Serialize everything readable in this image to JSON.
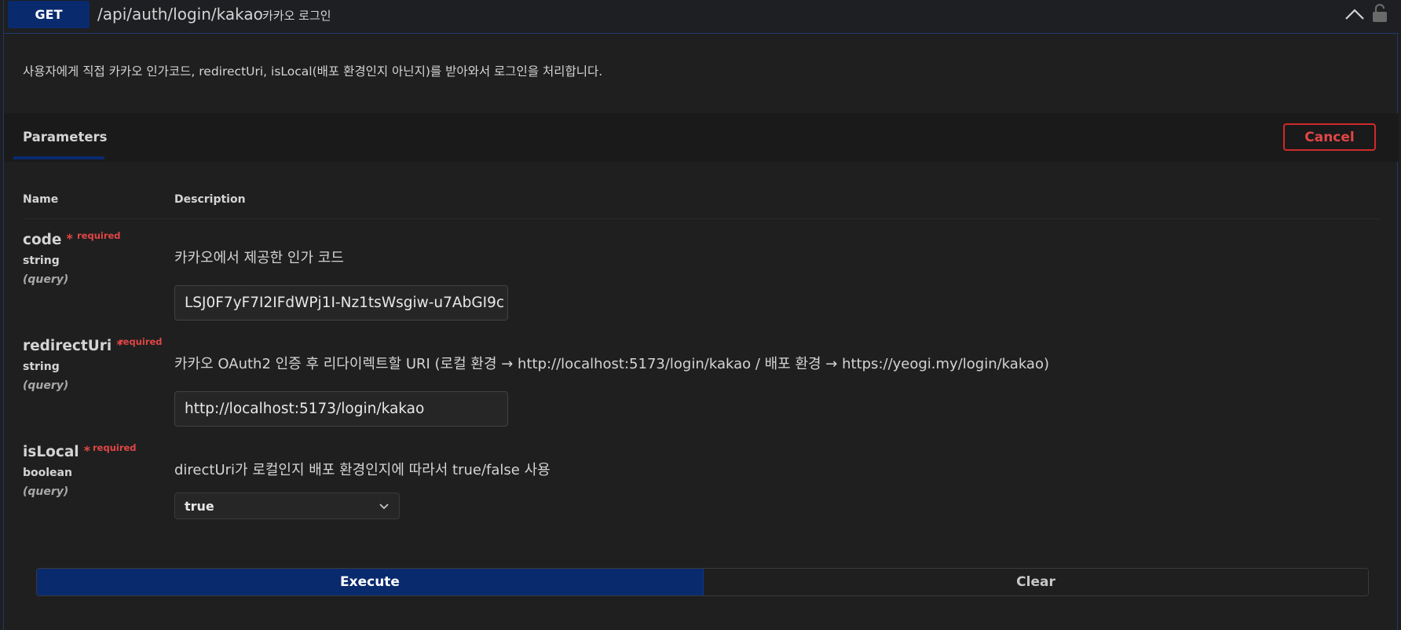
{
  "summary": {
    "method": "GET",
    "path": "/api/auth/login/kakao",
    "description": "카카오 로그인"
  },
  "operation_description": "사용자에게 직접 카카오 인가코드, redirectUri, isLocal(배포 환경인지 아닌지)를 받아와서 로그인을 처리합니다.",
  "parameters_section": {
    "tab_label": "Parameters",
    "cancel_label": "Cancel",
    "columns": {
      "name": "Name",
      "description": "Description"
    }
  },
  "params": [
    {
      "name": "code",
      "required_label": "required",
      "type": "string",
      "location": "(query)",
      "description": "카카오에서 제공한 인가 코드",
      "value": "LSJ0F7yF7I2IFdWPj1I-Nz1tsWsgiw-u7AbGI9c"
    },
    {
      "name": "redirectUri",
      "required_label": "required",
      "type": "string",
      "location": "(query)",
      "description": "카카오 OAuth2 인증 후 리다이렉트할 URI (로컬 환경 → http://localhost:5173/login/kakao / 배포 환경 → https://yeogi.my/login/kakao)",
      "value": "http://localhost:5173/login/kakao"
    },
    {
      "name": "isLocal",
      "required_label": "required",
      "type": "boolean",
      "location": "(query)",
      "description": "directUri가 로컬인지 배포 환경인지에 따라서 true/false 사용",
      "selected": "true"
    }
  ],
  "actions": {
    "execute_label": "Execute",
    "clear_label": "Clear"
  },
  "colors": {
    "method_bg": "#0a2a6e",
    "required": "#e04646",
    "cancel": "#cf2a2a"
  },
  "icons": [
    "chevron-up-icon",
    "lock-icon",
    "chevron-down-icon"
  ]
}
